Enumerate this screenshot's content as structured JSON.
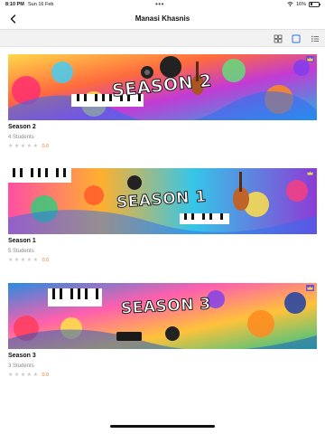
{
  "status_bar": {
    "time": "8:10 PM",
    "date": "Sun 16 Feb",
    "dots": "•••",
    "battery": "16%"
  },
  "nav": {
    "title": "Manasi Khasnis"
  },
  "courses": [
    {
      "banner_text": "SEASON 2",
      "title": "Season 2",
      "students": "4 Students",
      "rating": "0.0",
      "stars": 0
    },
    {
      "banner_text": "SEASON 1",
      "title": "Season 1",
      "students": "5 Students",
      "rating": "0.0",
      "stars": 0
    },
    {
      "banner_text": "SEASON 3",
      "title": "Season 3",
      "students": "3 Students",
      "rating": "0.0",
      "stars": 0
    }
  ],
  "colors": {
    "accent_rating": "#e07a2e",
    "crown": "#6b4bd8",
    "star_empty": "#c8c8c8"
  }
}
